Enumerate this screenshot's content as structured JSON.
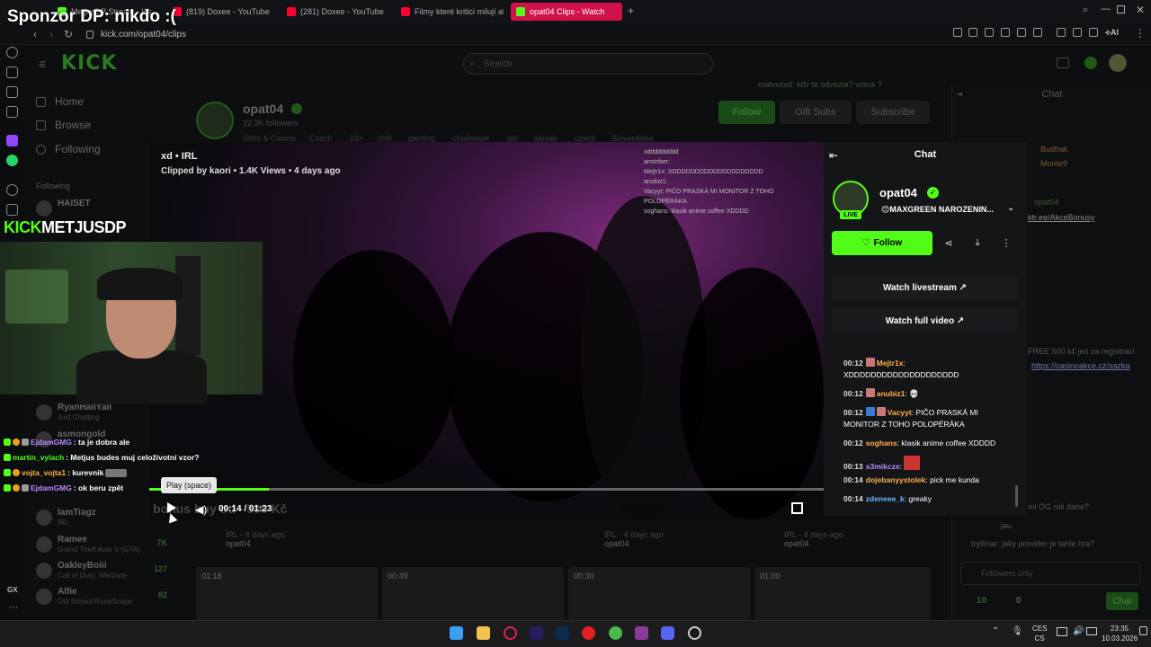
{
  "overlay": {
    "sponsor_text": "Sponzor DP: nikdo :(",
    "channel_banner_prefix": "KICK",
    "channel_banner_name": "METJUSDP",
    "stream_chat": [
      {
        "user": "EjdamGMG",
        "text": ": ta je dobra ale",
        "color": "#b98aff"
      },
      {
        "user": "martin_vylach",
        "text": ": Metjus budes muj celoživotní vzor?",
        "color": "#53fc18"
      },
      {
        "user": "vojta_vojta1",
        "text": ": kurevnik",
        "color": "#ffb04a"
      },
      {
        "user": "EjdamGMG",
        "text": ": ok beru zpět",
        "color": "#b98aff"
      }
    ]
  },
  "browser": {
    "tabs": [
      {
        "label": "MetjusDP Stream - Watc",
        "color": "#53fc18"
      },
      {
        "label": "(819) Doxee - YouTube",
        "color": "#ff0033"
      },
      {
        "label": "(281) Doxee - YouTube",
        "color": "#ff0033"
      },
      {
        "label": "Filmy které kritici milují ale",
        "color": "#ff0033"
      },
      {
        "label": "opat04 Clips - Watch",
        "color": "#53fc18"
      }
    ],
    "url": "kick.com/opat04/clips"
  },
  "kick": {
    "search_placeholder": "Search",
    "nav": [
      {
        "label": "Home"
      },
      {
        "label": "Browse"
      },
      {
        "label": "Following"
      }
    ],
    "following_heading": "Following",
    "following": [
      {
        "name": "HAISET",
        "game": "",
        "count": ""
      },
      {
        "name": "RyanHallYall",
        "game": "Just Chatting",
        "count": ""
      },
      {
        "name": "asmongold",
        "game": "",
        "count": ""
      },
      {
        "name": "lamTiagz",
        "game": "IRL",
        "count": ""
      },
      {
        "name": "Ramee",
        "game": "Grand Theft Auto V (GTA)",
        "count": "7K"
      },
      {
        "name": "OakleyBoiii",
        "game": "Call of Duty: Warzone",
        "count": "127"
      },
      {
        "name": "Alfie",
        "game": "Old School RuneScape",
        "count": "82"
      }
    ],
    "channel": {
      "name": "opat04",
      "followers": "22.3K followers",
      "tags": [
        "Slots & Casino",
        "Czech",
        "18+",
        "chill",
        "gaming",
        "challenger",
        "girl",
        "slovak",
        "czech",
        "Slovenština"
      ],
      "follow_label": "Follow",
      "gift_label": "Gift Subs",
      "subscribe_label": "Subscribe"
    },
    "right_chat": {
      "title": "Chat",
      "lines": [
        "matvvxxd: kdv te odvezla? vcera ?",
        "Budhak",
        "Monte9",
        "opat04",
        "ktr.ee/AkceBonusy",
        "FREE 500 kč jen za registraci",
        "https://casinoakce.cz/sazka",
        "mi OG roli dane?",
        "jau",
        "tryllinar: jaky provider je tahle hra?"
      ],
      "input_placeholder": "Followers only",
      "send_label": "Chat",
      "count_a": "10",
      "count_b": "0"
    }
  },
  "clip": {
    "title": "xd • IRL",
    "clipped_by": "Clipped by kaori • 1.4K Views • 4 days ago",
    "tooltip": "Play (space)",
    "time": "00:14 / 01:23",
    "background_title": "bonus buy od - 500 Kč",
    "progress": 0.177,
    "video_chat": [
      "xddddddddd",
      "anstriber:",
      "Mejtr1x: XDDDDDDDDDDDDDDDDDDDD",
      "anubiz1:",
      "Vacyyt: PIČO PRASKÁ MI MONITOR Z TOHO POLOPÉRÁKA",
      "soghans: klasik anime coffee XDDDD"
    ]
  },
  "modal_chat": {
    "title": "Chat",
    "channel_name": "opat04",
    "live_label": "LIVE",
    "stream_title": "😊MAXGREEN NAROZENIN...",
    "follow_label": "Follow",
    "watch_livestream": "Watch livestream",
    "watch_full_video": "Watch full video",
    "messages": [
      {
        "time": "00:12",
        "user": "Mejtr1x",
        "text": ": XDDDDDDDDDDDDDDDDDDDD",
        "color": "#ffb04a"
      },
      {
        "time": "00:12",
        "user": "anubiz1",
        "text": ":",
        "color": "#ffb04a"
      },
      {
        "time": "00:12",
        "user": "Vacyyt",
        "text": ": PIČO PRASKÁ MI MONITOR Z TOHO POLOPÉRÁKA",
        "color": "#ffb04a"
      },
      {
        "time": "00:12",
        "user": "soghans",
        "text": ": klasik anime coffee XDDDD",
        "color": "#ffb04a"
      },
      {
        "time": "00:13",
        "user": "s3mikcze",
        "text": ":",
        "color": "#b98aff"
      },
      {
        "time": "00:14",
        "user": "dojebanyystolek",
        "text": ": pick me kunda",
        "color": "#ffb04a"
      },
      {
        "time": "00:14",
        "user": "zdeneee_k",
        "text": ": greaky",
        "color": "#6fb3ff"
      }
    ]
  },
  "below": {
    "cards": [
      {
        "meta": "IRL - 4 days ago",
        "channel": "opat04"
      },
      {
        "meta": "IRL - 4 days ago",
        "channel": "opat04"
      },
      {
        "meta": "IRL - 4 days ago",
        "channel": "opat04"
      }
    ],
    "durations": [
      "01:18",
      "00:49",
      "00:30",
      "01:00"
    ]
  },
  "taskbar": {
    "lang_top": "CES",
    "lang_bottom": "CS",
    "time": "23:35",
    "date": "10.03.2026"
  },
  "browser_side": {
    "gx_label": "GX"
  }
}
